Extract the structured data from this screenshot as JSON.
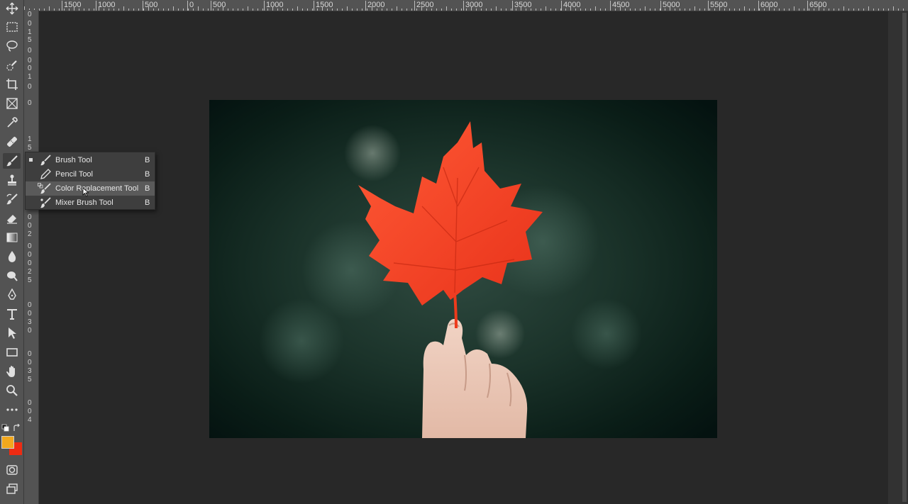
{
  "ruler": {
    "horizontal": [
      "1500",
      "1000",
      "500",
      "0",
      "500",
      "1000",
      "1500",
      "2000",
      "2500",
      "3000",
      "3500",
      "4000",
      "4500",
      "5000",
      "5500",
      "6000",
      "6500"
    ],
    "vertical": [
      "0",
      "0",
      "1",
      "5",
      "0",
      "0",
      "0",
      "1",
      "0",
      "0",
      "1",
      "5",
      "0",
      "0",
      "2",
      "0",
      "0",
      "0",
      "2",
      "5",
      "0",
      "0",
      "3",
      "0",
      "0",
      "0",
      "3",
      "5",
      "0",
      "0",
      "4"
    ]
  },
  "tool_flyout": {
    "items": [
      {
        "label": "Brush Tool",
        "shortcut": "B"
      },
      {
        "label": "Pencil Tool",
        "shortcut": "B"
      },
      {
        "label": "Color Replacement Tool",
        "shortcut": "B"
      },
      {
        "label": "Mixer Brush Tool",
        "shortcut": "B"
      }
    ]
  },
  "colors": {
    "foreground": "#f2a81d",
    "background": "#ee2b12",
    "leaf": "#ff4a2a",
    "photo_bg": "#0e2a22"
  },
  "tools": [
    "move-icon",
    "marquee-icon",
    "lasso-icon",
    "quick-select-icon",
    "crop-icon",
    "frame-icon",
    "eyedropper-icon",
    "healing-icon",
    "brush-icon",
    "stamp-icon",
    "history-brush-icon",
    "eraser-icon",
    "gradient-icon",
    "blur-icon",
    "dodge-icon",
    "pen-icon",
    "type-icon",
    "path-select-icon",
    "rectangle-icon",
    "hand-icon",
    "zoom-icon",
    "more-icon"
  ]
}
